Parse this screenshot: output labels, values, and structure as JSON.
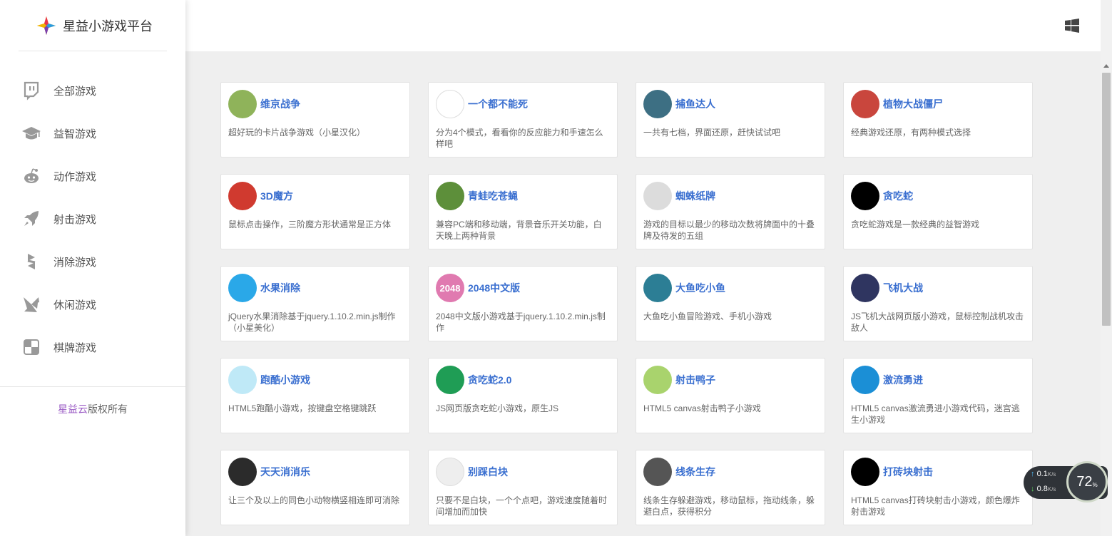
{
  "app": {
    "title": "星益小游戏平台"
  },
  "sidebar": {
    "items": [
      {
        "label": "全部游戏",
        "icon": "twitch-icon"
      },
      {
        "label": "益智游戏",
        "icon": "graduation-cap-icon"
      },
      {
        "label": "动作游戏",
        "icon": "reddit-icon"
      },
      {
        "label": "射击游戏",
        "icon": "rocket-icon"
      },
      {
        "label": "消除游戏",
        "icon": "hubspot-icon"
      },
      {
        "label": "休闲游戏",
        "icon": "pinwheel-icon"
      },
      {
        "label": "棋牌游戏",
        "icon": "checkerboard-icon"
      }
    ],
    "footer": {
      "brand": "星益云",
      "suffix": "版权所有"
    }
  },
  "topbar": {
    "icon": "windows-icon"
  },
  "games": [
    {
      "title": "维京战争",
      "desc": "超好玩的卡片战争游戏（小星汉化）",
      "thumb_color": "#8fb35a",
      "thumb_text": ""
    },
    {
      "title": "一个都不能死",
      "desc": "分为4个模式，看看你的反应能力和手速怎么样吧",
      "thumb_color": "#ffffff",
      "thumb_text": ""
    },
    {
      "title": "捕鱼达人",
      "desc": "一共有七档，界面还原，赶快试试吧",
      "thumb_color": "#3d6f83",
      "thumb_text": ""
    },
    {
      "title": "植物大战僵尸",
      "desc": "经典游戏还原，有两种模式选择",
      "thumb_color": "#c9463d",
      "thumb_text": ""
    },
    {
      "title": "3D魔方",
      "desc": "鼠标点击操作，三阶魔方形状通常是正方体",
      "thumb_color": "#d03a2f",
      "thumb_text": ""
    },
    {
      "title": "青蛙吃苍蝇",
      "desc": "兼容PC端和移动端，背景音乐开关功能，白天晚上两种背景",
      "thumb_color": "#5d8f3a",
      "thumb_text": ""
    },
    {
      "title": "蜘蛛纸牌",
      "desc": "游戏的目标以最少的移动次数将牌面中的十叠牌及待发的五组",
      "thumb_color": "#dcdcdc",
      "thumb_text": ""
    },
    {
      "title": "贪吃蛇",
      "desc": "贪吃蛇游戏是一款经典的益智游戏",
      "thumb_color": "#000000",
      "thumb_text": ""
    },
    {
      "title": "水果消除",
      "desc": "jQuery水果消除基于jquery.1.10.2.min.js制作（小星美化）",
      "thumb_color": "#2aa8e8",
      "thumb_text": ""
    },
    {
      "title": "2048中文版",
      "desc": "2048中文版小游戏基于jquery.1.10.2.min.js制作",
      "thumb_color": "#e07ab0",
      "thumb_text": "2048"
    },
    {
      "title": "大鱼吃小鱼",
      "desc": "大鱼吃小鱼冒险游戏、手机小游戏",
      "thumb_color": "#2c7e95",
      "thumb_text": ""
    },
    {
      "title": "飞机大战",
      "desc": "JS飞机大战网页版小游戏，鼠标控制战机攻击敌人",
      "thumb_color": "#2f3560",
      "thumb_text": ""
    },
    {
      "title": "跑酷小游戏",
      "desc": "HTML5跑酷小游戏，按键盘空格键跳跃",
      "thumb_color": "#bfe9f7",
      "thumb_text": ""
    },
    {
      "title": "贪吃蛇2.0",
      "desc": "JS网页版贪吃蛇小游戏，原生JS",
      "thumb_color": "#1f9d55",
      "thumb_text": ""
    },
    {
      "title": "射击鸭子",
      "desc": "HTML5 canvas射击鸭子小游戏",
      "thumb_color": "#a9d36d",
      "thumb_text": ""
    },
    {
      "title": "激流勇进",
      "desc": "HTML5 canvas激流勇进小游戏代码，迷宫逃生小游戏",
      "thumb_color": "#1b8fd6",
      "thumb_text": ""
    },
    {
      "title": "天天消消乐",
      "desc": "让三个及以上的同色小动物横竖相连即可消除",
      "thumb_color": "#2b2b2b",
      "thumb_text": ""
    },
    {
      "title": "别踩白块",
      "desc": "只要不是白块，一个个点吧，游戏速度随着时间增加而加快",
      "thumb_color": "#eeeeee",
      "thumb_text": ""
    },
    {
      "title": "线条生存",
      "desc": "线条生存躲避游戏，移动鼠标，拖动线条，躲避白点，获得积分",
      "thumb_color": "#555555",
      "thumb_text": ""
    },
    {
      "title": "打砖块射击",
      "desc": "HTML5 canvas打砖块射击小游戏，颜色爆炸射击游戏",
      "thumb_color": "#000000",
      "thumb_text": ""
    }
  ],
  "netmon": {
    "up": "0.1",
    "down": "0.8",
    "unit": "K/s",
    "percent": "72",
    "percent_unit": "%"
  }
}
